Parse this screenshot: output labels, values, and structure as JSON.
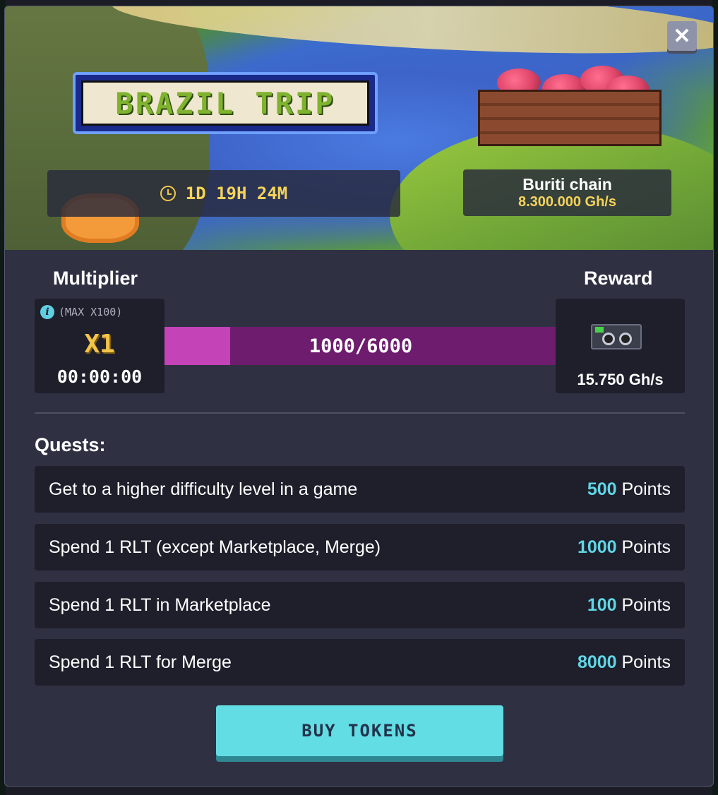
{
  "event": {
    "title": "BRAZIL TRIP",
    "timer": "1D 19H 24M",
    "chain_name": "Buriti chain",
    "chain_power": "8.300.000 Gh/s"
  },
  "multiplier": {
    "label": "Multiplier",
    "max_label": "(MAX X100)",
    "value": "X1",
    "time": "00:00:00"
  },
  "progress": {
    "current": 1000,
    "total": 6000,
    "text": "1000/6000"
  },
  "reward": {
    "label": "Reward",
    "icon": "gpu-miner-icon",
    "value": "15.750 Gh/s"
  },
  "quests": {
    "title": "Quests:",
    "items": [
      {
        "text": "Get to a higher difficulty level in a game",
        "points": "500",
        "unit": " Points"
      },
      {
        "text": "Spend 1 RLT (except Marketplace, Merge)",
        "points": "1000",
        "unit": " Points"
      },
      {
        "text": "Spend 1 RLT in Marketplace",
        "points": "100",
        "unit": " Points"
      },
      {
        "text": "Spend 1 RLT for Merge",
        "points": "8000",
        "unit": " Points"
      }
    ]
  },
  "buttons": {
    "close": "✕",
    "buy": "BUY TOKENS"
  },
  "colors": {
    "accent": "#62dde4",
    "progress_fill": "#c443b6",
    "progress_track": "#6e1c6e",
    "gold": "#f3d35a",
    "panel": "#2f3042"
  }
}
